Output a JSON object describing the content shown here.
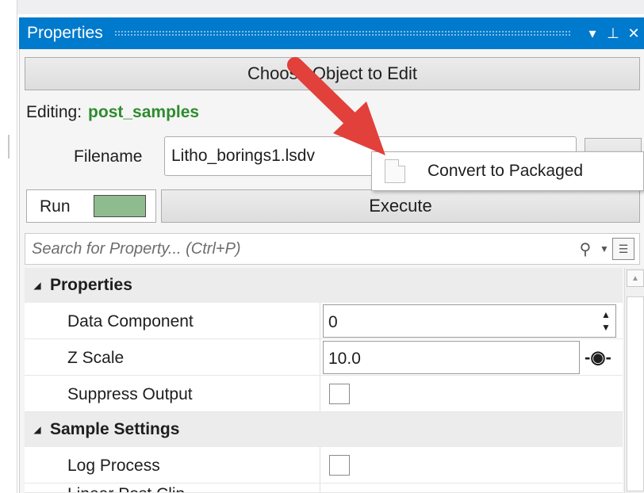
{
  "window": {
    "title": "Properties",
    "controls": {
      "pin_dropdown": "▾",
      "pin": "⊥",
      "close": "✕"
    }
  },
  "toolbar": {
    "choose_label": "Choose Object to Edit"
  },
  "editing": {
    "prefix": "Editing:",
    "object_name": "post_samples"
  },
  "filename": {
    "label": "Filename",
    "value": "Litho_borings1.lsdv"
  },
  "run": {
    "label": "Run",
    "swatch_color": "#8fbc8f",
    "execute_label": "Execute"
  },
  "search": {
    "placeholder": "Search for Property...  (Ctrl+P)"
  },
  "grid": {
    "categories": [
      {
        "label": "Properties"
      },
      {
        "label": "Sample Settings"
      }
    ],
    "rows": [
      {
        "name": "Data Component",
        "value": "0"
      },
      {
        "name": "Z Scale",
        "value": "10.0"
      },
      {
        "name": "Suppress Output",
        "checked": false
      },
      {
        "name": "Log Process",
        "checked": false
      },
      {
        "name": "Linear Post Clip"
      }
    ]
  },
  "context_menu": {
    "item": "Convert to Packaged",
    "icon": "document-icon"
  },
  "annotation": {
    "arrow_color": "#e2403b"
  }
}
